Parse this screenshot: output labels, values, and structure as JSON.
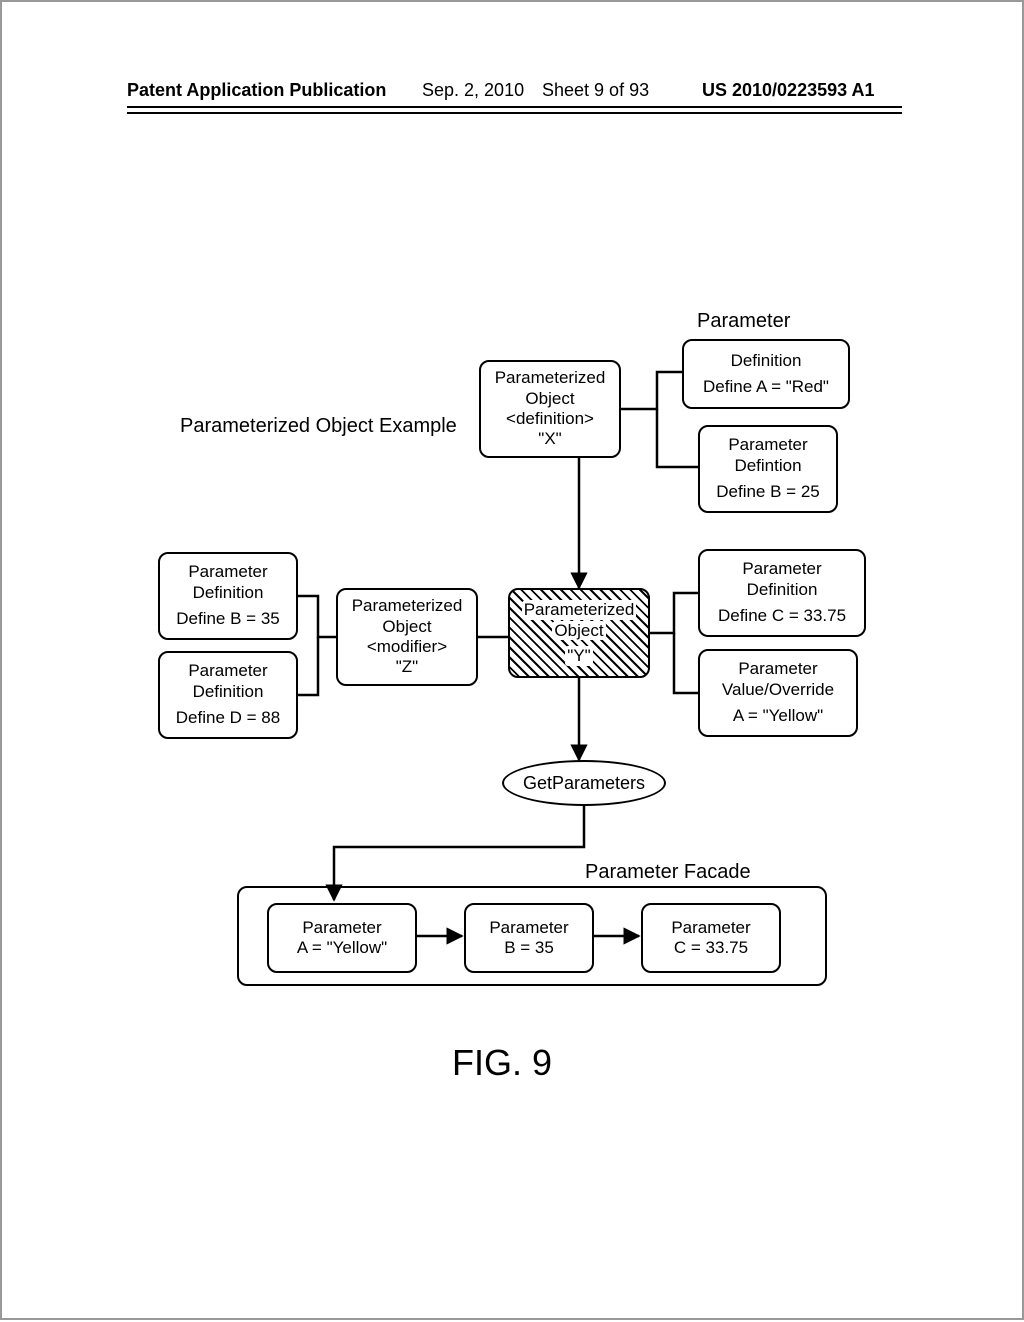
{
  "header": {
    "left": "Patent Application Publication",
    "date": "Sep. 2, 2010",
    "sheet": "Sheet 9 of 93",
    "pub": "US 2010/0223593 A1"
  },
  "labels": {
    "title": "Parameterized Object Example",
    "parameterWord": "Parameter",
    "facadeLabel": "Parameter Facade",
    "figure": "FIG. 9"
  },
  "nodes": {
    "defA": {
      "t1": "Definition",
      "t2": "Define A = \"Red\""
    },
    "defB25": {
      "t1": "Parameter",
      "t2": "Defintion",
      "t3": "Define B = 25"
    },
    "defB35": {
      "t1": "Parameter",
      "t2": "Definition",
      "t3": "Define B = 35"
    },
    "defD88": {
      "t1": "Parameter",
      "t2": "Definition",
      "t3": "Define D = 88"
    },
    "defC": {
      "t1": "Parameter",
      "t2": "Definition",
      "t3": "Define C = 33.75"
    },
    "valA": {
      "t1": "Parameter",
      "t2": "Value/Override",
      "t3": "A = \"Yellow\""
    },
    "objX": {
      "t1": "Parameterized",
      "t2": "Object",
      "t3": "<definition>",
      "t4": "\"X\""
    },
    "objZ": {
      "t1": "Parameterized",
      "t2": "Object",
      "t3": "<modifier>",
      "t4": "\"Z\""
    },
    "objY": {
      "t1": "Parameterized",
      "t2": "Object",
      "t4": "\"Y\""
    },
    "getParams": "GetParameters"
  },
  "facade": {
    "pA": {
      "t1": "Parameter",
      "t2": "A = \"Yellow\""
    },
    "pB": {
      "t1": "Parameter",
      "t2": "B = 35"
    },
    "pC": {
      "t1": "Parameter",
      "t2": "C = 33.75"
    }
  }
}
